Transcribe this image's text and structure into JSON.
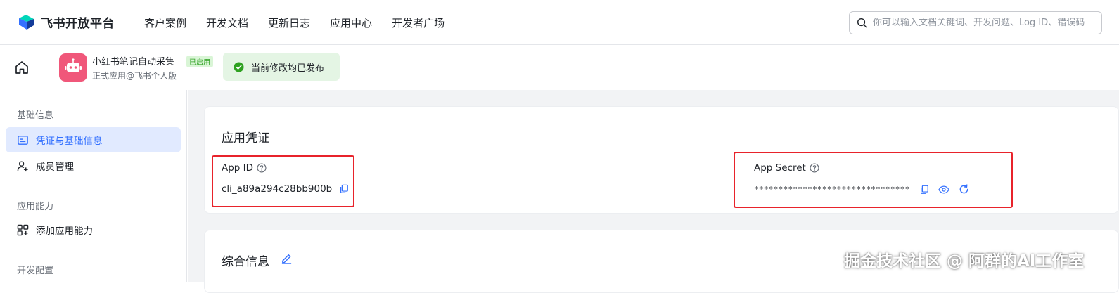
{
  "brand": {
    "name": "飞书开放平台",
    "color": "#3370ff"
  },
  "nav": {
    "items": [
      "客户案例",
      "开发文档",
      "更新日志",
      "应用中心",
      "开发者广场"
    ]
  },
  "search": {
    "placeholder": "你可以输入文档关键词、开发问题、Log ID、错误码",
    "icon": "search-icon"
  },
  "app": {
    "name": "小红书笔记自动采集",
    "status_badge": "已启用",
    "subtitle": "正式应用@飞书个人版",
    "publish_status": "当前修改均已发布",
    "avatar_icon": "robot-icon",
    "avatar_color": "#f0577a"
  },
  "sidebar": {
    "sections": [
      {
        "title": "基础信息",
        "items": [
          {
            "label": "凭证与基础信息",
            "icon": "credential-icon",
            "active": true
          },
          {
            "label": "成员管理",
            "icon": "user-add-icon",
            "active": false
          }
        ]
      },
      {
        "title": "应用能力",
        "items": [
          {
            "label": "添加应用能力",
            "icon": "grid-add-icon",
            "active": false
          }
        ]
      },
      {
        "title": "开发配置",
        "items": []
      }
    ]
  },
  "credentials": {
    "title": "应用凭证",
    "app_id_label": "App ID",
    "app_id_value": "cli_a89a294c28bb900b",
    "app_secret_label": "App Secret",
    "app_secret_value": "********************************"
  },
  "general_info": {
    "title": "综合信息"
  },
  "watermark": "掘金技术社区 @ 阿群的AI工作室",
  "colors": {
    "accent": "#3370ff",
    "highlight_box": "#e8232b",
    "success": "#2ea121"
  }
}
